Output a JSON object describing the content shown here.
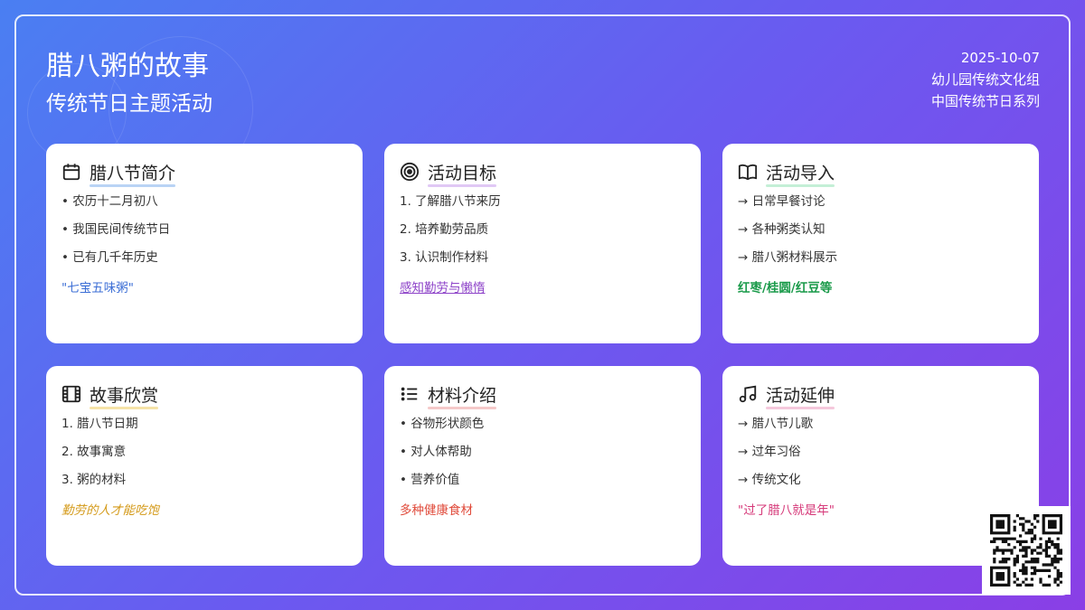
{
  "header": {
    "title": "腊八粥的故事",
    "subtitle": "传统节日主题活动",
    "date": "2025-10-07",
    "org": "幼儿园传统文化组",
    "series": "中国传统节日系列"
  },
  "cards": [
    {
      "title": "腊八节简介",
      "icon": "calendar-icon",
      "underline": "#b9d3f5",
      "items": [
        "• 农历十二月初八",
        "• 我国民间传统节日",
        "• 已有几千年历史"
      ],
      "accent": "\"七宝五味粥\"",
      "accent_color": "#3d6fd6"
    },
    {
      "title": "活动目标",
      "icon": "target-icon",
      "underline": "#e0c8f5",
      "items": [
        "1. 了解腊八节来历",
        "2. 培养勤劳品质",
        "3. 认识制作材料"
      ],
      "accent": "感知勤劳与懒惰",
      "accent_color": "#8e44c9"
    },
    {
      "title": "活动导入",
      "icon": "book-icon",
      "underline": "#c4efd6",
      "items": [
        "→ 日常早餐讨论",
        "→ 各种粥类认知",
        "→ 腊八粥材料展示"
      ],
      "accent": "红枣/桂圆/红豆等",
      "accent_color": "#1a9a4a"
    },
    {
      "title": "故事欣赏",
      "icon": "film-icon",
      "underline": "#f6e3a8",
      "items": [
        "1. 腊八节日期",
        "2. 故事寓意",
        "3. 粥的材料"
      ],
      "accent": "勤劳的人才能吃饱",
      "accent_color": "#d49a1a"
    },
    {
      "title": "材料介绍",
      "icon": "list-icon",
      "underline": "#f5c9c9",
      "items": [
        "• 谷物形状颜色",
        "• 对人体帮助",
        "• 营养价值"
      ],
      "accent": "多种健康食材",
      "accent_color": "#e04a3a"
    },
    {
      "title": "活动延伸",
      "icon": "music-note-icon",
      "underline": "#f5c8dc",
      "items": [
        "→ 腊八节儿歌",
        "→ 过年习俗",
        "→ 传统文化"
      ],
      "accent": "\"过了腊八就是年\"",
      "accent_color": "#d63a7a"
    }
  ]
}
